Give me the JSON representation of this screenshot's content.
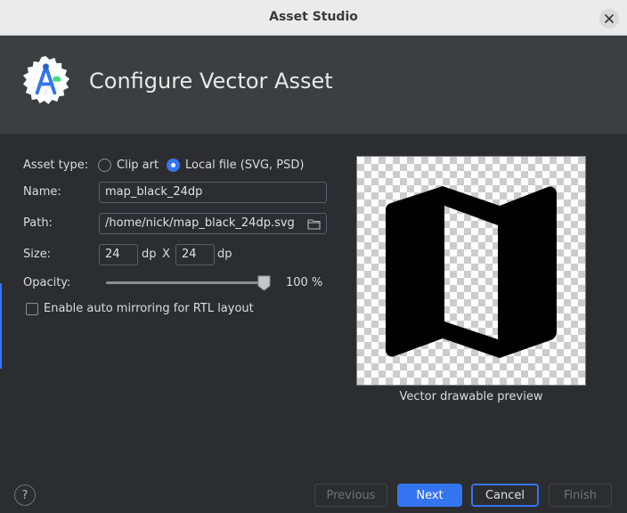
{
  "window": {
    "title": "Asset Studio",
    "close_icon": "close-icon"
  },
  "header": {
    "heading": "Configure Vector Asset",
    "logo_icon": "android-studio-logo-icon"
  },
  "form": {
    "asset_type_label": "Asset type:",
    "asset_type_options": [
      "Clip art",
      "Local file (SVG, PSD)"
    ],
    "asset_type_selected": "Local file (SVG, PSD)",
    "name_label": "Name:",
    "name_value": "map_black_24dp",
    "path_label": "Path:",
    "path_value": "/home/nick/map_black_24dp.svg",
    "size_label": "Size:",
    "size_width": "24",
    "size_height": "24",
    "size_unit": "dp",
    "size_separator": "X",
    "opacity_label": "Opacity:",
    "opacity_value": "100 %",
    "opacity_fraction": 1.0,
    "mirroring_label": "Enable auto mirroring for RTL layout",
    "mirroring_checked": false
  },
  "preview": {
    "caption": "Vector drawable preview",
    "icon": "map-icon"
  },
  "footer": {
    "help_label": "?",
    "previous_label": "Previous",
    "next_label": "Next",
    "cancel_label": "Cancel",
    "finish_label": "Finish"
  },
  "colors": {
    "accent": "#3574f0",
    "background": "#2b2d30",
    "header": "#3c3f41",
    "titlebar": "#ebebeb"
  }
}
